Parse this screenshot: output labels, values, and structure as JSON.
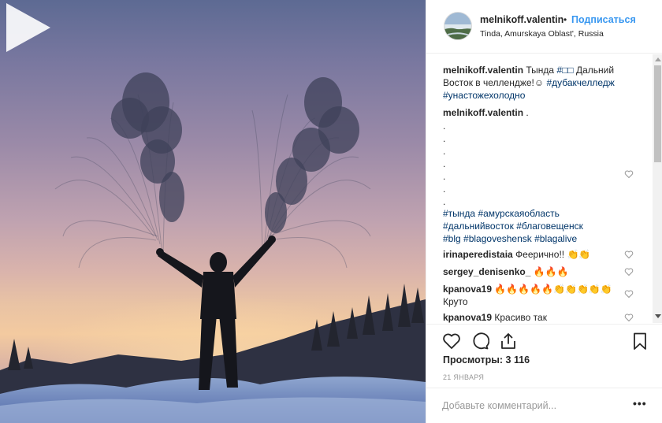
{
  "post": {
    "username": "melnikoff.valentin",
    "separator": "•",
    "follow_label": "Подписаться",
    "location": "Tinda, Amurskaya Oblast', Russia",
    "media_alt": "video",
    "caption": {
      "username": "melnikoff.valentin",
      "text_start": " Тында ",
      "hashtag_flag": "#□□",
      "text_mid": " Дальний Восток в челлендже!☺ ",
      "hashtag_1": "#дубакчелледж",
      "hashtag_2": "#унастожехолодно"
    },
    "author_comment": {
      "username": "melnikoff.valentin",
      "text": " .",
      "dots": [
        ".",
        ".",
        ".",
        ".",
        ".",
        ".",
        "."
      ],
      "hashtags": [
        "#тында",
        "#амурскаяобласть",
        "#дальнийвосток",
        "#благовещенск",
        "#blg",
        "#blagoveshensk",
        "#blagalive"
      ]
    },
    "comments": [
      {
        "username": "irinaperedistaia",
        "text": " Феерично!! 👏👏"
      },
      {
        "username": "sergey_denisenko_",
        "text": " 🔥🔥🔥"
      },
      {
        "username": "kpanova19",
        "text": " 🔥🔥🔥🔥🔥👏👏👏👏👏",
        "line2": "Круто"
      },
      {
        "username": "kpanova19",
        "text": " Красиво так"
      }
    ],
    "views_label": "Просмотры: ",
    "views_count": "3 116",
    "date": "21 ЯНВАРЯ",
    "comment_placeholder": "Добавьте комментарий...",
    "more_label": "•••"
  },
  "icons": {
    "play": "play-icon",
    "like": "heart-icon",
    "comment": "comment-icon",
    "share": "share-icon",
    "save": "bookmark-icon",
    "comment_like": "small-heart-icon"
  },
  "colors": {
    "link": "#3897f0",
    "hashtag": "#003569",
    "muted": "#999999"
  }
}
